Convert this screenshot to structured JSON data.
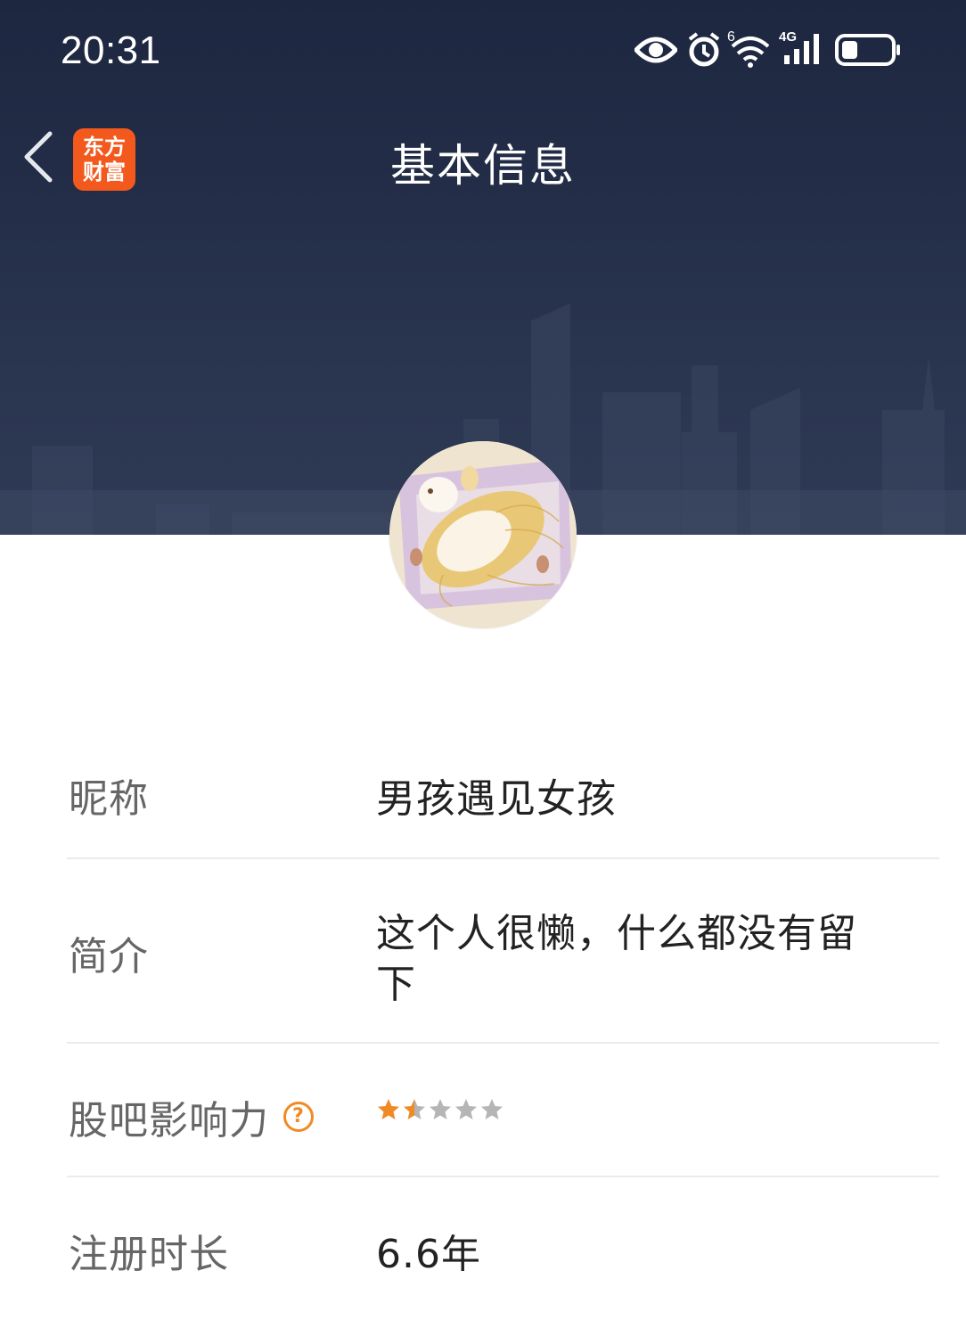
{
  "status_bar": {
    "time": "20:31",
    "icons": [
      "eye-icon",
      "alarm-icon",
      "wifi-6-icon",
      "signal-4g-icon",
      "battery-icon"
    ]
  },
  "nav": {
    "title": "基本信息",
    "back_icon": "chevron-left-icon",
    "app_logo_line1": "东方",
    "app_logo_line2": "财富"
  },
  "colors": {
    "header_bg": "#1e2740",
    "accent": "#f08a24",
    "logo_bg": "#f3591d",
    "divider": "#ebebeb"
  },
  "profile": {
    "rows": [
      {
        "label": "昵称",
        "value": "男孩遇见女孩"
      },
      {
        "label": "简介",
        "value_line1": "这个人很懒，什么都没有留",
        "value_line2": "下"
      },
      {
        "label": "股吧影响力",
        "help_icon": "question-circle-icon",
        "rating": 1.5,
        "rating_max": 5
      },
      {
        "label": "注册时长",
        "value": "6.6年"
      }
    ]
  }
}
